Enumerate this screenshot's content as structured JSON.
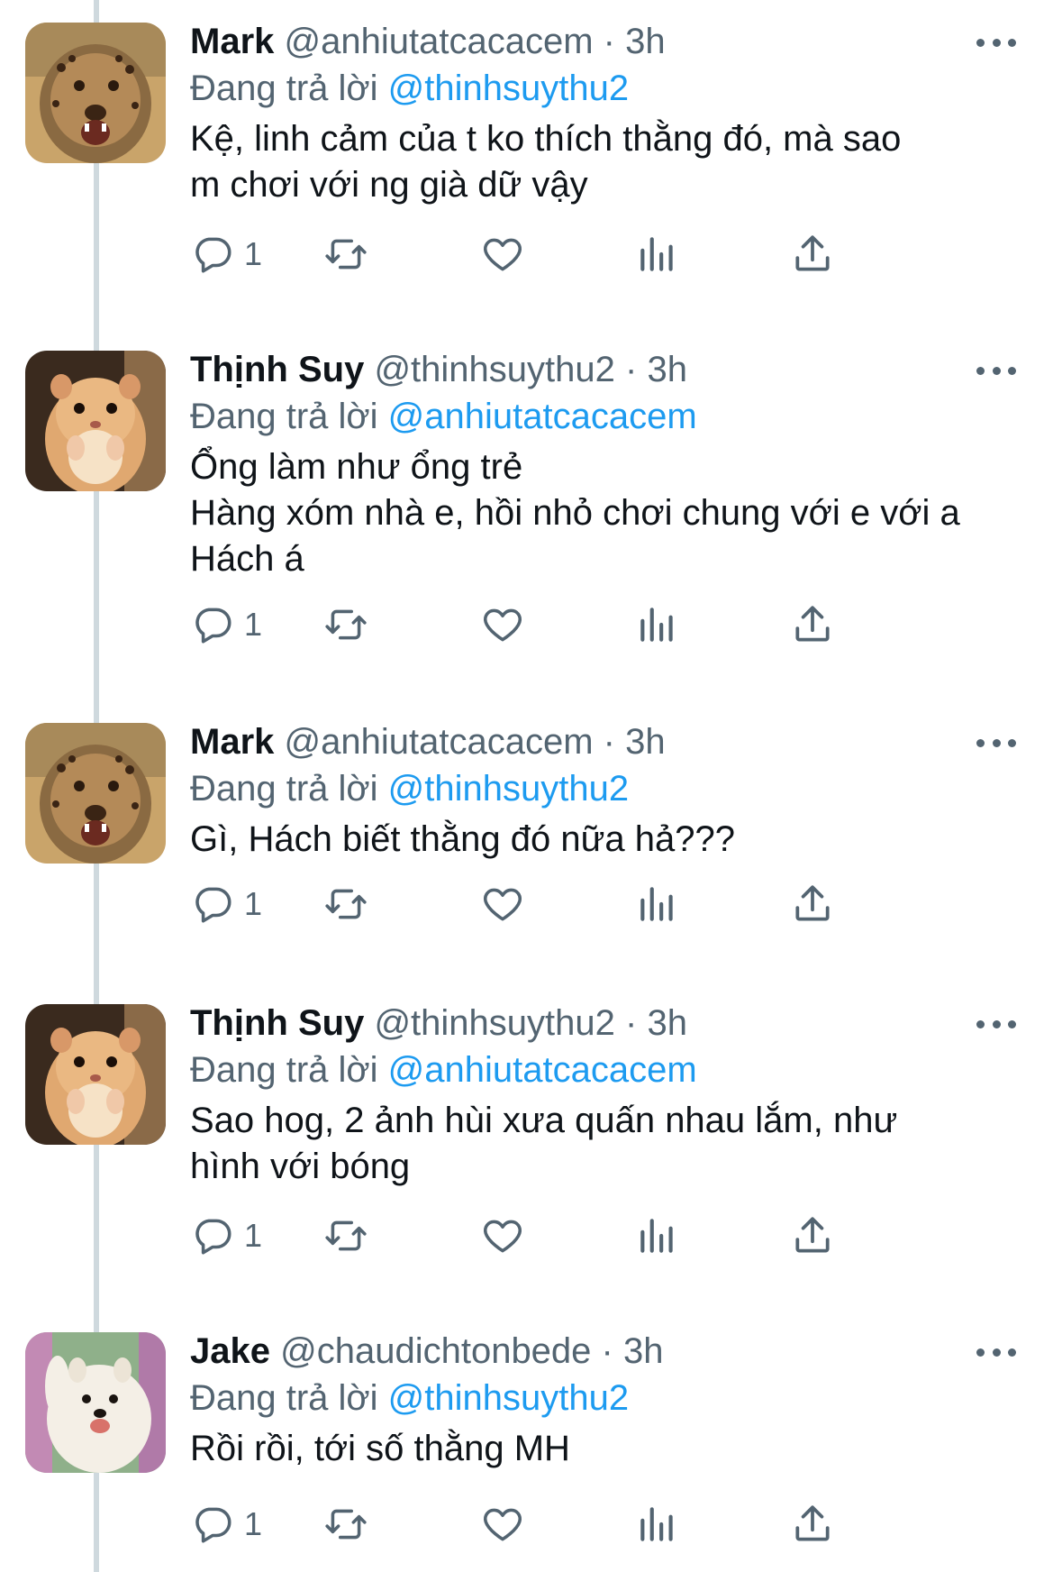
{
  "colors": {
    "text": "#0f1419",
    "secondary": "#536471",
    "link": "#1d9bf0",
    "thread_line": "#cfd9de"
  },
  "tweets": [
    {
      "name": "Mark",
      "handle": "@anhiutatcacacem",
      "time": "· 3h",
      "reply_prefix": "Đang trả lời",
      "reply_to": "@thinhsuythu2",
      "body": [
        "Kệ, linh cảm của t ko thích thằng đó, mà sao",
        "m chơi với ng già dữ vậy"
      ],
      "reply_count": "1",
      "avatar": "cheetah-cub-avatar"
    },
    {
      "name": "Thịnh Suy",
      "handle": "@thinhsuythu2",
      "time": "· 3h",
      "reply_prefix": "Đang trả lời",
      "reply_to": "@anhiutatcacacem",
      "body": [
        "Ổng làm như ổng trẻ",
        "Hàng xóm nhà e, hồi nhỏ chơi chung với e với a",
        "Hách á"
      ],
      "reply_count": "1",
      "avatar": "hamster-avatar"
    },
    {
      "name": "Mark",
      "handle": "@anhiutatcacacem",
      "time": "· 3h",
      "reply_prefix": "Đang trả lời",
      "reply_to": "@thinhsuythu2",
      "body": [
        "Gì, Hách biết thằng đó nữa hả???"
      ],
      "reply_count": "1",
      "avatar": "cheetah-cub-avatar"
    },
    {
      "name": "Thịnh Suy",
      "handle": "@thinhsuythu2",
      "time": "· 3h",
      "reply_prefix": "Đang trả lời",
      "reply_to": "@anhiutatcacacem",
      "body": [
        "Sao hog, 2 ảnh hùi xưa quấn nhau lắm, như",
        "hình với bóng"
      ],
      "reply_count": "1",
      "avatar": "hamster-avatar"
    },
    {
      "name": "Jake",
      "handle": "@chaudichtonbede",
      "time": "· 3h",
      "reply_prefix": "Đang trả lời",
      "reply_to": "@thinhsuythu2",
      "body": [
        "Rồi rồi, tới số thằng MH"
      ],
      "reply_count": "1",
      "avatar": "samoyed-dog-avatar"
    }
  ]
}
